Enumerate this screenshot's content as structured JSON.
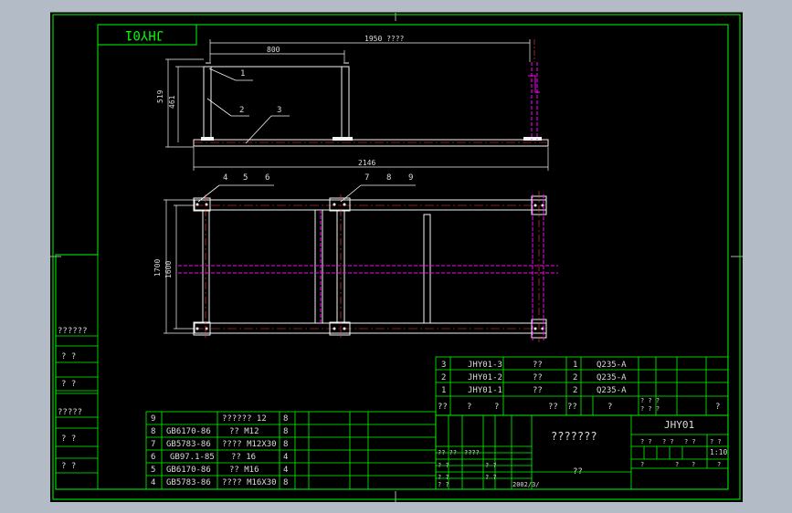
{
  "drawing": {
    "code_box": "JHY01",
    "dims": {
      "overall_top": "1950 ????",
      "width_800": "800",
      "height_519": "519",
      "height_461": "461",
      "overall_2146": "2146",
      "height_1700": "1700",
      "height_1600": "1600"
    },
    "callouts": {
      "c1": "1",
      "c2": "2",
      "c3": "3",
      "c456": [
        "4",
        "5",
        "6"
      ],
      "c789": [
        "7",
        "8",
        "9"
      ]
    }
  },
  "left_strip": [
    "??????",
    "?  ?",
    "?  ?",
    "?????",
    "?  ?",
    "?  ?"
  ],
  "parts_top": {
    "rows": [
      [
        "3",
        "JHY01-3",
        "??",
        "1",
        "Q235-A"
      ],
      [
        "2",
        "JHY01-2",
        "??",
        "2",
        "Q235-A"
      ],
      [
        "1",
        "JHY01-1",
        "??",
        "2",
        "Q235-A"
      ]
    ],
    "header": [
      "??",
      "?",
      "?",
      "??",
      "??",
      "?",
      "? ? ?\n? ? ?",
      "?"
    ]
  },
  "parts_bottom": {
    "rows": [
      [
        "9",
        "",
        "?????? 12",
        "8"
      ],
      [
        "8",
        "GB6170-86",
        "??  M12",
        "8"
      ],
      [
        "7",
        "GB5783-86",
        "????  M12X30",
        "8"
      ],
      [
        "6",
        "GB97.1-85",
        "??  16",
        "4"
      ],
      [
        "5",
        "GB6170-86",
        "??  M16",
        "4"
      ],
      [
        "4",
        "GB5783-86",
        "????  M16X30",
        "8"
      ]
    ]
  },
  "title_block": {
    "name": "???????",
    "code": "JHY01",
    "material": "??",
    "scale": "1:10",
    "left_labels": [
      "?? ??",
      "????",
      "? ?",
      "?  ?",
      "?  ?",
      "?  ?",
      "?  ?",
      "2002/3/"
    ],
    "right_small": [
      "? ?",
      "? ?",
      "? ?",
      "? ?",
      "?",
      "?",
      "?",
      "?"
    ]
  },
  "colors": {
    "frame": "#00ff00",
    "part": "#f5f5f5",
    "hidden": "#ff00ff",
    "center": "#ff3b3b",
    "text": "#dcdcdc",
    "background": "#000000"
  }
}
